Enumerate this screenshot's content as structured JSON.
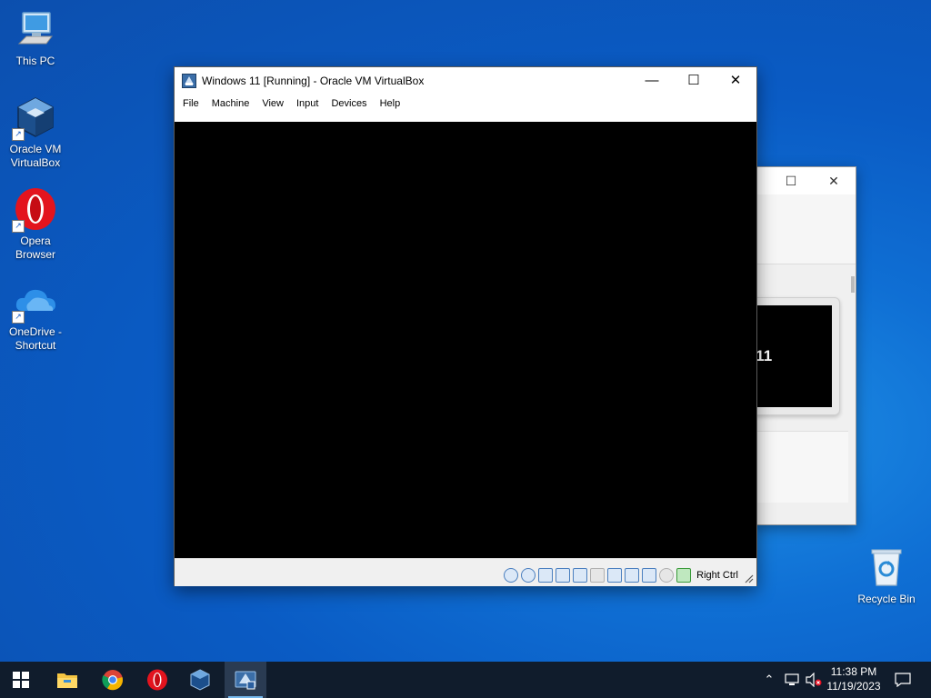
{
  "desktop": {
    "icons": [
      {
        "label": "This PC",
        "icon": "computer-icon"
      },
      {
        "label": "Oracle VM VirtualBox",
        "icon": "virtualbox-icon"
      },
      {
        "label": "Opera Browser",
        "icon": "opera-icon"
      },
      {
        "label": "OneDrive - Shortcut",
        "icon": "onedrive-icon"
      },
      {
        "label": "Recycle Bin",
        "icon": "recycle-bin-icon"
      }
    ]
  },
  "background_window": {
    "visible_text": "s 11"
  },
  "vbox_window": {
    "title": "Windows 11 [Running] - Oracle VM VirtualBox",
    "menu": [
      "File",
      "Machine",
      "View",
      "Input",
      "Devices",
      "Help"
    ],
    "status_icons": [
      "hard-disk-icon",
      "optical-drive-icon",
      "audio-icon",
      "network-icon",
      "usb-icon",
      "shared-folders-icon",
      "display-icon",
      "video-capture-icon",
      "mouse-integration-icon",
      "keyboard-icon"
    ],
    "host_key": "Right Ctrl"
  },
  "taskbar": {
    "apps": [
      "file-explorer-icon",
      "chrome-icon",
      "opera-icon",
      "virtualbox-icon",
      "virtualbox-vm-icon"
    ],
    "time": "11:38 PM",
    "date": "11/19/2023"
  },
  "colors": {
    "desktop_blue": "#0a5bc4",
    "taskbar": "#101c2c",
    "accent": "#76b9ed"
  }
}
